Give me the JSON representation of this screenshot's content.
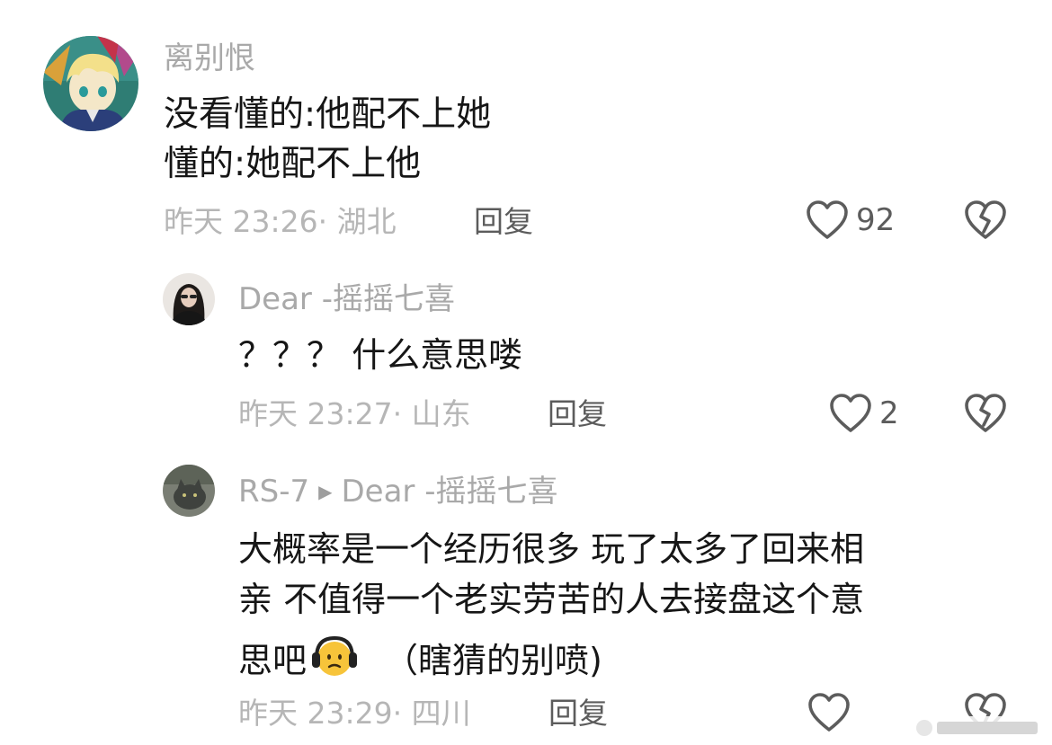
{
  "comments": [
    {
      "username": "离别恨",
      "lines": [
        "没看懂的:他配不上她",
        "懂的:她配不上他"
      ],
      "time": "昨天 23:26",
      "separator": "·",
      "location": "湖北",
      "reply_label": "回复",
      "likes": "92"
    },
    {
      "username": "Dear -摇摇七喜",
      "lines": [
        "？？？ 什么意思喽"
      ],
      "time": "昨天 23:27",
      "separator": "·",
      "location": "山东",
      "reply_label": "回复",
      "likes": "2"
    },
    {
      "username": "RS-7",
      "reply_to": "Dear -摇摇七喜",
      "lines": [
        "大概率是一个经历很多 玩了太多了回来相",
        "亲 不值得一个老实劳苦的人去接盘这个意",
        "思吧",
        "（瞎猜的别喷)"
      ],
      "time": "昨天 23:29",
      "separator": "·",
      "location": "四川",
      "reply_label": "回复",
      "likes": ""
    }
  ],
  "icons": {
    "like": "heart-outline-icon",
    "dislike": "broken-heart-icon",
    "reply_arrow": "play-arrow-icon",
    "emoji": "headphones-face-emoji"
  },
  "colors": {
    "username": "#a9a9a9",
    "text": "#161616",
    "meta": "#b6b6b6",
    "action": "#5c5c5c"
  }
}
